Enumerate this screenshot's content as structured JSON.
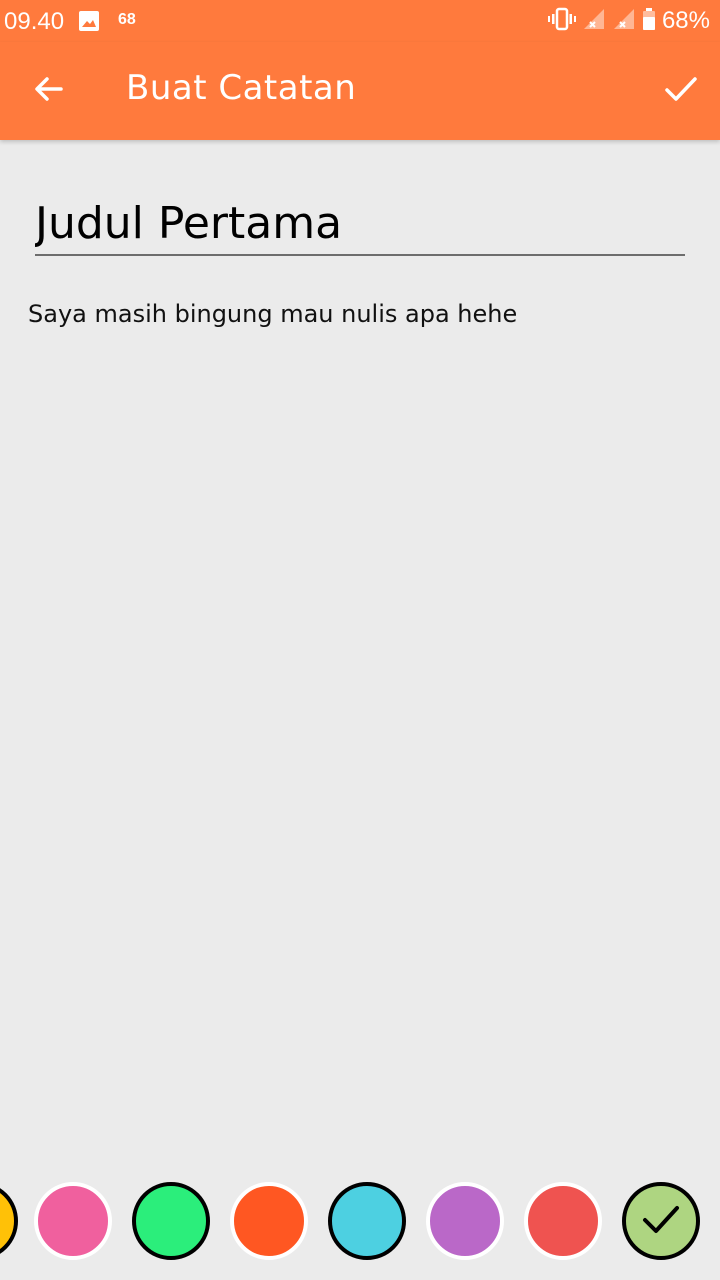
{
  "status_bar": {
    "time": "09.40",
    "notification_count": "68",
    "battery_percent": "68%",
    "icons": [
      "image-icon",
      "vibrate-icon",
      "signal-icon",
      "signal-icon",
      "battery-icon"
    ]
  },
  "app_bar": {
    "title": "Buat Catatan",
    "back_icon": "arrow-left-icon",
    "save_icon": "check-icon",
    "color": "#ff7a3d"
  },
  "note": {
    "title_value": "Judul Pertama",
    "body_value": "Saya masih bingung mau nulis apa hehe"
  },
  "colors": [
    {
      "name": "yellow",
      "hex": "#ffc107",
      "selected": false
    },
    {
      "name": "pink",
      "hex": "#f0609e",
      "selected": false
    },
    {
      "name": "green",
      "hex": "#2bee7b",
      "selected": false
    },
    {
      "name": "deep-orange",
      "hex": "#ff5722",
      "selected": false
    },
    {
      "name": "cyan",
      "hex": "#4dd0e1",
      "selected": false
    },
    {
      "name": "purple",
      "hex": "#ba68c8",
      "selected": false
    },
    {
      "name": "red",
      "hex": "#ef5350",
      "selected": false
    },
    {
      "name": "light-green",
      "hex": "#aed581",
      "selected": true
    }
  ]
}
